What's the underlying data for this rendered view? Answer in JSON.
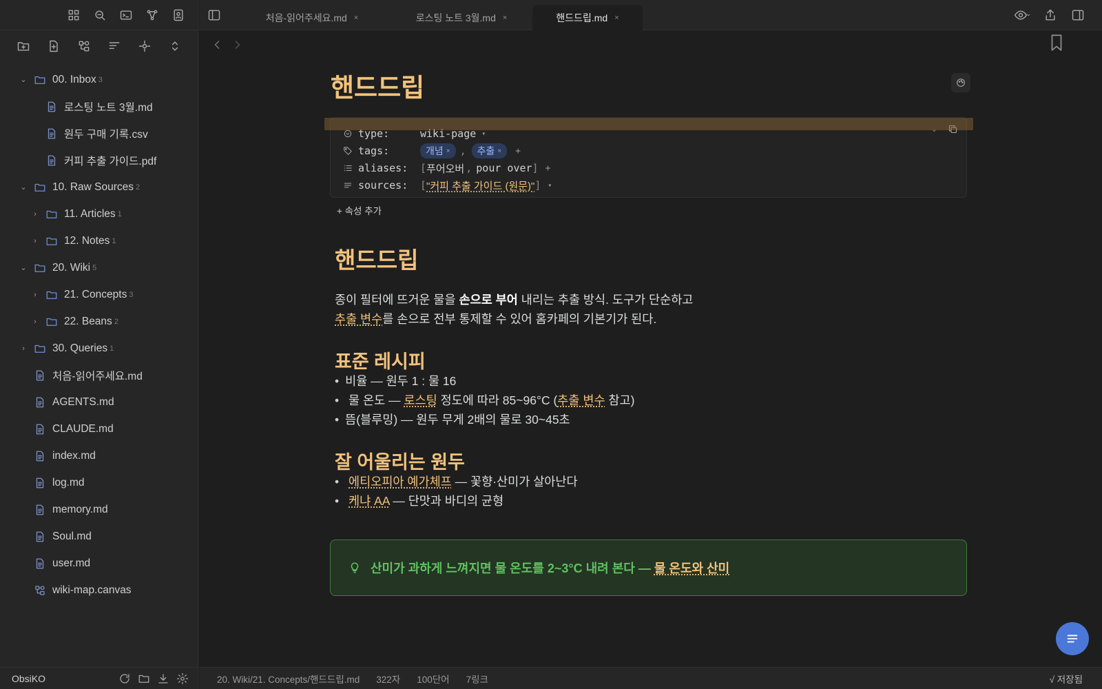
{
  "app": {
    "vault_name": "ObsiKO"
  },
  "tabs": [
    {
      "label": "처음-읽어주세요.md",
      "close": "×"
    },
    {
      "label": "로스팅 노트 3월.md",
      "close": "×"
    },
    {
      "label": "핸드드립.md",
      "close": "×",
      "active": true
    }
  ],
  "tree": [
    {
      "type": "folder",
      "label": "00. Inbox",
      "count": "3",
      "open": true,
      "chevron": "⌄"
    },
    {
      "type": "file",
      "label": "로스팅 노트 3월.md"
    },
    {
      "type": "file",
      "label": "원두 구매 기록.csv"
    },
    {
      "type": "file",
      "label": "커피 추출 가이드.pdf"
    },
    {
      "type": "folder",
      "label": "10. Raw Sources",
      "count": "2",
      "open": true,
      "chevron": "⌄"
    },
    {
      "type": "folder",
      "label": "11. Articles",
      "count": "1",
      "chevron": "›"
    },
    {
      "type": "folder",
      "label": "12. Notes",
      "count": "1",
      "chevron": "›"
    },
    {
      "type": "folder",
      "label": "20. Wiki",
      "count": "5",
      "open": true,
      "chevron": "⌄"
    },
    {
      "type": "folder",
      "label": "21. Concepts",
      "count": "3",
      "chevron": "›"
    },
    {
      "type": "folder",
      "label": "22. Beans",
      "count": "2",
      "chevron": "›"
    },
    {
      "type": "folder",
      "label": "30. Queries",
      "count": "1",
      "chevron": "›"
    },
    {
      "type": "file",
      "label": "처음-읽어주세요.md"
    },
    {
      "type": "file",
      "label": "AGENTS.md"
    },
    {
      "type": "file",
      "label": "CLAUDE.md"
    },
    {
      "type": "file",
      "label": "index.md"
    },
    {
      "type": "file",
      "label": "log.md"
    },
    {
      "type": "file",
      "label": "memory.md"
    },
    {
      "type": "file",
      "label": "Soul.md"
    },
    {
      "type": "file",
      "label": "user.md"
    },
    {
      "type": "canvas",
      "label": "wiki-map.canvas"
    }
  ],
  "note": {
    "title": "핸드드립",
    "properties": {
      "type_key": "type:",
      "type_value": "wiki-page",
      "tags_key": "tags:",
      "tags": [
        "개념",
        "추출"
      ],
      "aliases_key": "aliases:",
      "aliases": [
        "푸어오버",
        "pour over"
      ],
      "sources_key": "sources:",
      "sources_value": "\"커피 추출 가이드 (원문)\"",
      "add_property": "+ 속성 추가"
    },
    "h1": "핸드드립",
    "para_1a": "종이 필터에 뜨거운 물을 ",
    "para_1b": "손으로 부어",
    "para_1c": " 내리는 추출 방식. 도구가 단순하고",
    "para_2_link": "추출 변수",
    "para_2b": "를 손으로 전부 통제할 수 있어 홈카페의 기본기가 된다.",
    "h2_recipe": "표준 레시피",
    "recipe_1": "비율 — 원두 1 : 물 16",
    "recipe_2a": "물 온도 — ",
    "recipe_2_link1": "로스팅",
    "recipe_2b": " 정도에 따라 85~96°C (",
    "recipe_2_link2": "추출 변수",
    "recipe_2c": " 참고)",
    "recipe_3": "뜸(블루밍) — 원두 무게 2배의 물로 30~45초",
    "h2_beans": "잘 어울리는 원두",
    "bean_1_link": "에티오피아 예가체프",
    "bean_1_text": " — 꽃향·산미가 살아난다",
    "bean_2_link": "케냐 AA",
    "bean_2_text": " — 단맛과 바디의 균형",
    "callout_text": "산미가 과하게 느껴지면 물 온도를 2~3°C 내려 본다 — ",
    "callout_link": "물 온도와 산미"
  },
  "status": {
    "path": "20. Wiki/21. Concepts/핸드드립.md",
    "chars": "322자",
    "words": "100단어",
    "links": "7링크",
    "saved": "√ 저장됨"
  }
}
